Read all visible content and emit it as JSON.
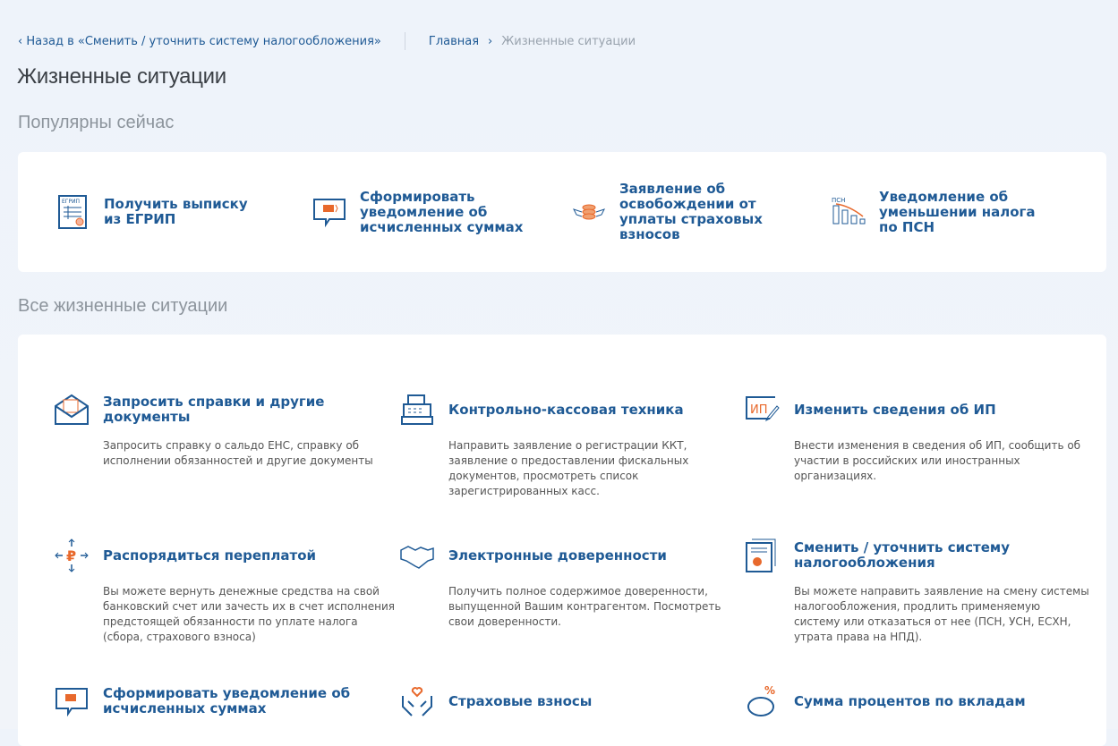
{
  "breadcrumbs": {
    "back": "Назад в «Сменить / уточнить систему налогообложения»",
    "home": "Главная",
    "current": "Жизненные ситуации"
  },
  "page_title": "Жизненные ситуации",
  "popular": {
    "heading": "Популярны сейчас",
    "items": [
      {
        "icon": "egrip-document-icon",
        "title": "Получить выписку из ЕГРИП",
        "badge": "ЕГРИП"
      },
      {
        "icon": "chat-card-icon",
        "title": "Сформировать уведомление об исчисленных суммах"
      },
      {
        "icon": "coins-wings-icon",
        "title": "Заявление об освобождении от уплаты страховых взносов"
      },
      {
        "icon": "psn-chart-icon",
        "title": "Уведомление об уменьшении налога по ПСН",
        "badge": "ПСН"
      }
    ]
  },
  "all": {
    "heading": "Все жизненные ситуации",
    "items": [
      {
        "icon": "envelope-icon",
        "title": "Запросить справки и другие документы",
        "desc": "Запросить справку о сальдо ЕНС, справку об исполнении обязанностей и другие документы"
      },
      {
        "icon": "cash-register-icon",
        "title": "Контрольно-кассовая техника",
        "desc": "Направить заявление о регистрации ККТ, заявление о предоставлении фискальных документов, просмотреть список зарегистрированных касс."
      },
      {
        "icon": "ip-edit-icon",
        "title": "Изменить сведения об ИП",
        "desc": "Внести изменения в сведения об ИП, сообщить об участии в российских или иностранных организациях.",
        "badge": "ИП"
      },
      {
        "icon": "ruble-arrows-icon",
        "title": "Распорядиться переплатой",
        "desc": "Вы можете вернуть денежные средства на свой банковский счет или зачесть их в счет исполнения предстоящей обязанности по уплате налога (сбора, страхового взноса)"
      },
      {
        "icon": "handshake-icon",
        "title": "Электронные доверенности",
        "desc": "Получить полное содержимое доверенности, выпущенной Вашим контрагентом. Посмотреть свои доверенности."
      },
      {
        "icon": "tax-system-document-icon",
        "title": "Сменить / уточнить систему налогообложения",
        "desc": "Вы можете направить заявление на смену системы налогообложения, продлить применяемую систему или отказаться от нее (ПСН, УСН, ЕСХН, утрата права на НПД)."
      },
      {
        "icon": "chat-card-icon",
        "title": "Сформировать уведомление об исчисленных суммах",
        "desc": ""
      },
      {
        "icon": "hands-heart-icon",
        "title": "Страховые взносы",
        "desc": ""
      },
      {
        "icon": "piggy-bank-icon",
        "title": "Сумма процентов по вкладам",
        "desc": ""
      }
    ]
  },
  "colors": {
    "accent": "#1f5a95",
    "icon_orange": "#e8692c"
  }
}
